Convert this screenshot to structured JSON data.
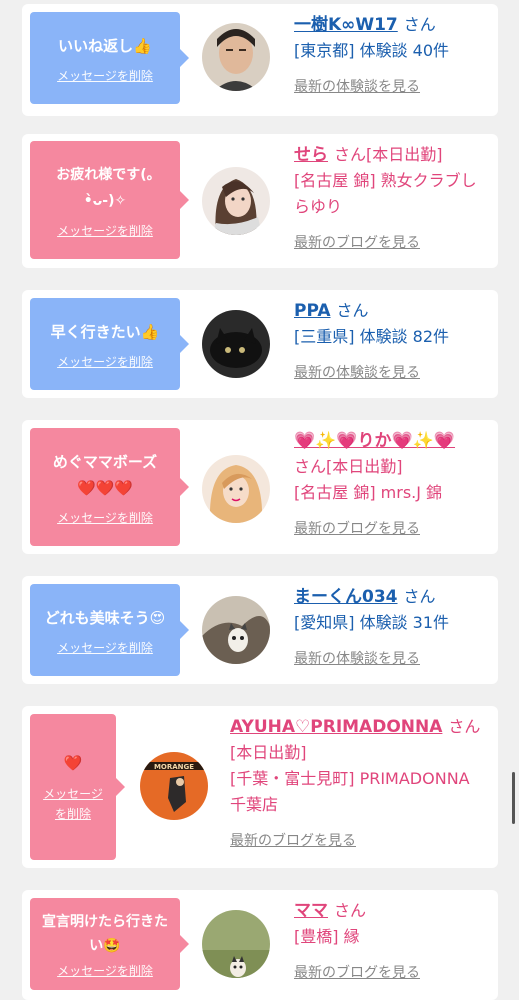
{
  "delete_label": "メッセージを削除",
  "delete_label_split": [
    "メッセージ",
    "を削除"
  ],
  "cards": [
    {
      "message": "いいね返し👍",
      "name": "一樹K∞W17",
      "san": "さん",
      "meta": "[東京都] 体験談 40件",
      "latest": "最新の体験談を見る",
      "theme": "blue",
      "avatar_icon": "man-portrait-icon"
    },
    {
      "message": "お疲れ様です(｡•̀ᴗ-)✧",
      "name": "せら",
      "san": "さん[本日出勤]",
      "meta": "[名古屋 錦] 熟女クラブしらゆり",
      "latest": "最新のブログを見る",
      "theme": "pink",
      "avatar_icon": "woman-portrait-icon"
    },
    {
      "message": "早く行きたい👍",
      "name": "PPA",
      "san": "さん",
      "meta": "[三重県] 体験談 82件",
      "latest": "最新の体験談を見る",
      "theme": "blue",
      "avatar_icon": "black-cat-icon"
    },
    {
      "message": "めぐママボーズ❤️❤️❤️",
      "name": "💗✨💗りか💗✨💗",
      "san": "さん[本日出勤]",
      "meta": "[名古屋 錦] mrs.J 錦",
      "latest": "最新のブログを見る",
      "theme": "pink",
      "avatar_icon": "blonde-woman-icon"
    },
    {
      "message": "どれも美味そう😍",
      "name": "まーくん034",
      "san": "さん",
      "meta": "[愛知県] 体験談 31件",
      "latest": "最新の体験談を見る",
      "theme": "blue",
      "avatar_icon": "kitten-icon"
    },
    {
      "message": "❤️",
      "name": "AYUHA♡PRIMADONNA",
      "san": "さん[本日出勤]",
      "meta": "[千葉・富士見町] PRIMADONNA 千葉店",
      "latest": "最新のブログを見る",
      "theme": "pink",
      "avatar_icon": "orange-poster-icon"
    },
    {
      "message": "宣言明けたら行きたい🤩",
      "name": "ママ",
      "san": "さん",
      "meta": "[豊橋] 縁",
      "latest": "最新のブログを見る",
      "theme": "pink",
      "avatar_icon": "cat-on-grass-icon"
    }
  ],
  "colors": {
    "blue_bubble": "#8ab4f8",
    "pink_bubble": "#f5889f",
    "blue_text": "#1b5fae",
    "pink_text": "#e0457b"
  }
}
